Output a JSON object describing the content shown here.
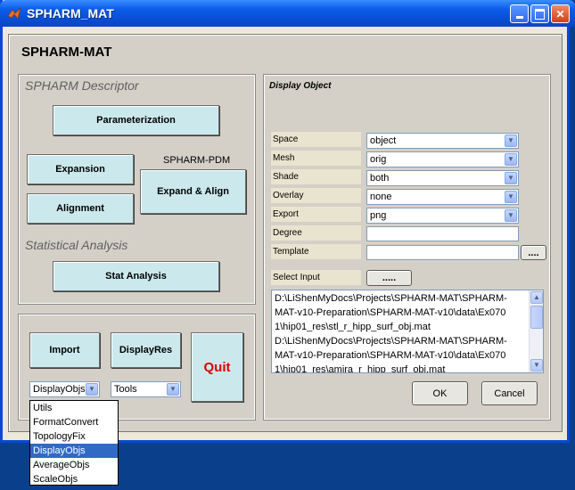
{
  "window": {
    "title": "SPHARM_MAT"
  },
  "app": {
    "title": "SPHARM-MAT"
  },
  "descriptor": {
    "section_label": "SPHARM Descriptor",
    "parameterization": "Parameterization",
    "expansion": "Expansion",
    "alignment": "Alignment",
    "pdm_label": "SPHARM-PDM",
    "expand_align": "Expand & Align",
    "stat_section_label": "Statistical Analysis",
    "stat_analysis": "Stat Analysis"
  },
  "bottom": {
    "import": "Import",
    "displayres": "DisplayRes",
    "quit": "Quit",
    "left_select": "DisplayObjs",
    "right_select": "Tools",
    "dropdown_options": [
      "Utils",
      "FormatConvert",
      "TopologyFix",
      "DisplayObjs",
      "AverageObjs",
      "ScaleObjs"
    ],
    "dropdown_selected": "DisplayObjs",
    "quit_color": "#e00000"
  },
  "display": {
    "heading": "Display Object",
    "fields": [
      {
        "label": "Space",
        "value": "object",
        "type": "select"
      },
      {
        "label": "Mesh",
        "value": "orig",
        "type": "select"
      },
      {
        "label": "Shade",
        "value": "both",
        "type": "select"
      },
      {
        "label": "Overlay",
        "value": "none",
        "type": "select"
      },
      {
        "label": "Export",
        "value": "png",
        "type": "select"
      },
      {
        "label": "Degree",
        "value": "",
        "type": "text"
      },
      {
        "label": "Template",
        "value": "",
        "type": "text"
      }
    ],
    "template_browse": "....",
    "select_input_label": "Select Input",
    "select_input_browse": ".....",
    "input_lines": [
      "D:\\LiShenMyDocs\\Projects\\SPHARM-MAT\\SPHARM-",
      "MAT-v10-Preparation\\SPHARM-MAT-v10\\data\\Ex070",
      "1\\hip01_res\\stl_r_hipp_surf_obj.mat",
      "D:\\LiShenMyDocs\\Projects\\SPHARM-MAT\\SPHARM-",
      "MAT-v10-Preparation\\SPHARM-MAT-v10\\data\\Ex070",
      "1\\hip01_res\\amira_r_hipp_surf_obj.mat"
    ],
    "ok": "OK",
    "cancel": "Cancel"
  },
  "colors": {
    "button_face": "#cbe9ec",
    "panel_bg": "#d4d0c8",
    "titlebar": "#0a4fd6",
    "desktop": "#0a3f8c"
  }
}
